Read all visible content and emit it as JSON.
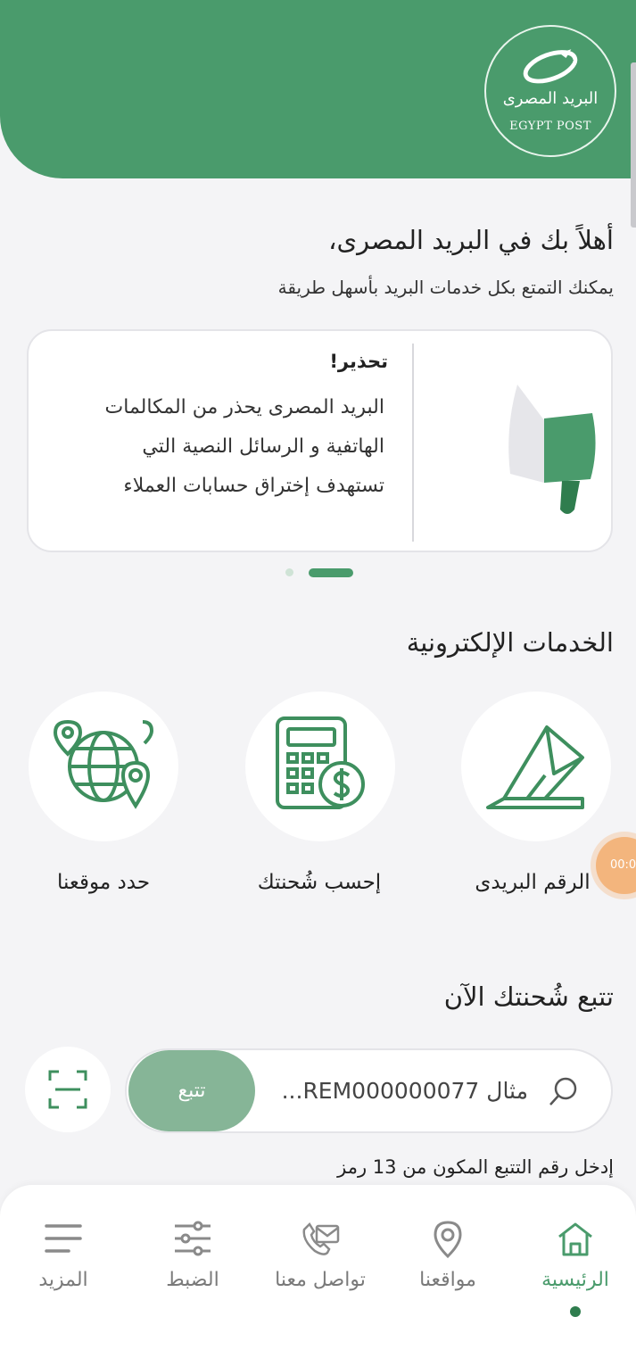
{
  "brand": {
    "name_ar": "البريد المصرى",
    "name_en": "EGYPT POST"
  },
  "welcome": {
    "title": "أهلاً بك في البريد المصرى،",
    "subtitle": "يمكنك التمتع بكل خدمات البريد بأسهل طريقة"
  },
  "alert": {
    "title": "تحذير!",
    "lines": [
      "البريد المصرى يحذر من المكالمات",
      "الهاتفية و الرسائل النصية التي",
      "تستهدف إختراق حسابات العملاء"
    ]
  },
  "services": {
    "title": "الخدمات الإلكترونية",
    "items": [
      {
        "label": "الرقم البريدى",
        "icon": "envelope-icon"
      },
      {
        "label": "إحسب شُحنتك",
        "icon": "calculator-dollar-icon"
      },
      {
        "label": "حدد موقعنا",
        "icon": "globe-location-icon"
      }
    ]
  },
  "floating_bubble": {
    "text": "00:0"
  },
  "tracking": {
    "title": "تتبع شُحنتك الآن",
    "placeholder": "مثال REM000000077...",
    "button": "تتبع",
    "hint": "إدخل رقم التتبع المكون من 13 رمز"
  },
  "nav": {
    "items": [
      {
        "label": "الرئيسية",
        "icon": "home-icon",
        "active": true
      },
      {
        "label": "مواقعنا",
        "icon": "location-pin-icon",
        "active": false
      },
      {
        "label": "تواصل معنا",
        "icon": "phone-mail-icon",
        "active": false
      },
      {
        "label": "الضبط",
        "icon": "sliders-icon",
        "active": false
      },
      {
        "label": "المزيد",
        "icon": "menu-icon",
        "active": false
      }
    ]
  },
  "colors": {
    "primary": "#4a9b6c",
    "button": "#86b597",
    "background": "#f4f4f6"
  }
}
